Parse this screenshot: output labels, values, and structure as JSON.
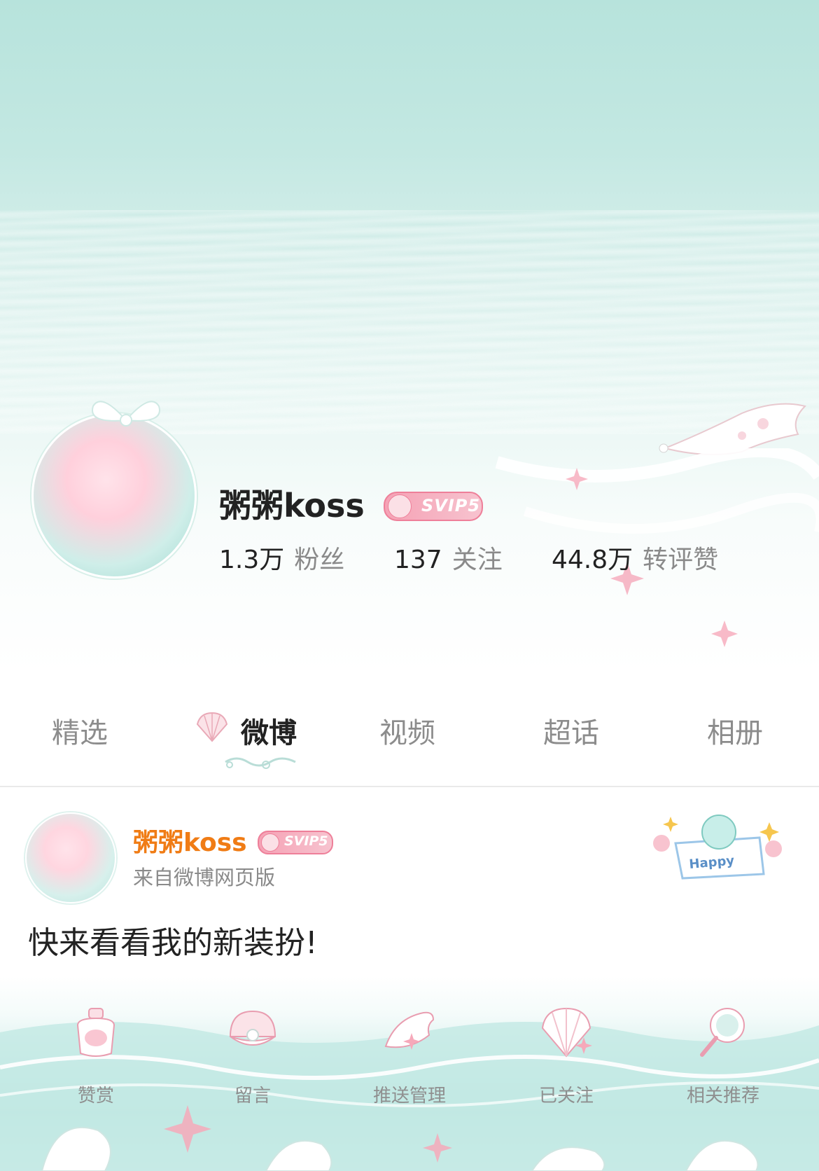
{
  "profile": {
    "name": "粥粥koss",
    "badge": "SVIP5",
    "stats": [
      {
        "value": "1.3万",
        "label": "粉丝"
      },
      {
        "value": "137",
        "label": "关注"
      },
      {
        "value": "44.8万",
        "label": "转评赞"
      }
    ]
  },
  "tabs": [
    {
      "label": "精选",
      "active": false
    },
    {
      "label": "微博",
      "active": true
    },
    {
      "label": "视频",
      "active": false
    },
    {
      "label": "超话",
      "active": false
    },
    {
      "label": "相册",
      "active": false
    }
  ],
  "post": {
    "author": "粥粥koss",
    "badge": "SVIP5",
    "source": "来自微博网页版",
    "text": "快来看看我的新装扮!",
    "sticker_text": "Happy"
  },
  "bottom_nav": [
    {
      "label": "赞赏",
      "icon": "perfume-bottle-icon"
    },
    {
      "label": "留言",
      "icon": "shell-pearl-icon"
    },
    {
      "label": "推送管理",
      "icon": "conch-icon"
    },
    {
      "label": "已关注",
      "icon": "scallop-icon"
    },
    {
      "label": "相关推荐",
      "icon": "mirror-icon"
    }
  ],
  "colors": {
    "banner_top": "#b7e3dc",
    "author_orange": "#f07c15",
    "svip_pink": "#f5a2b5",
    "text_gray": "#8a8a8a"
  }
}
